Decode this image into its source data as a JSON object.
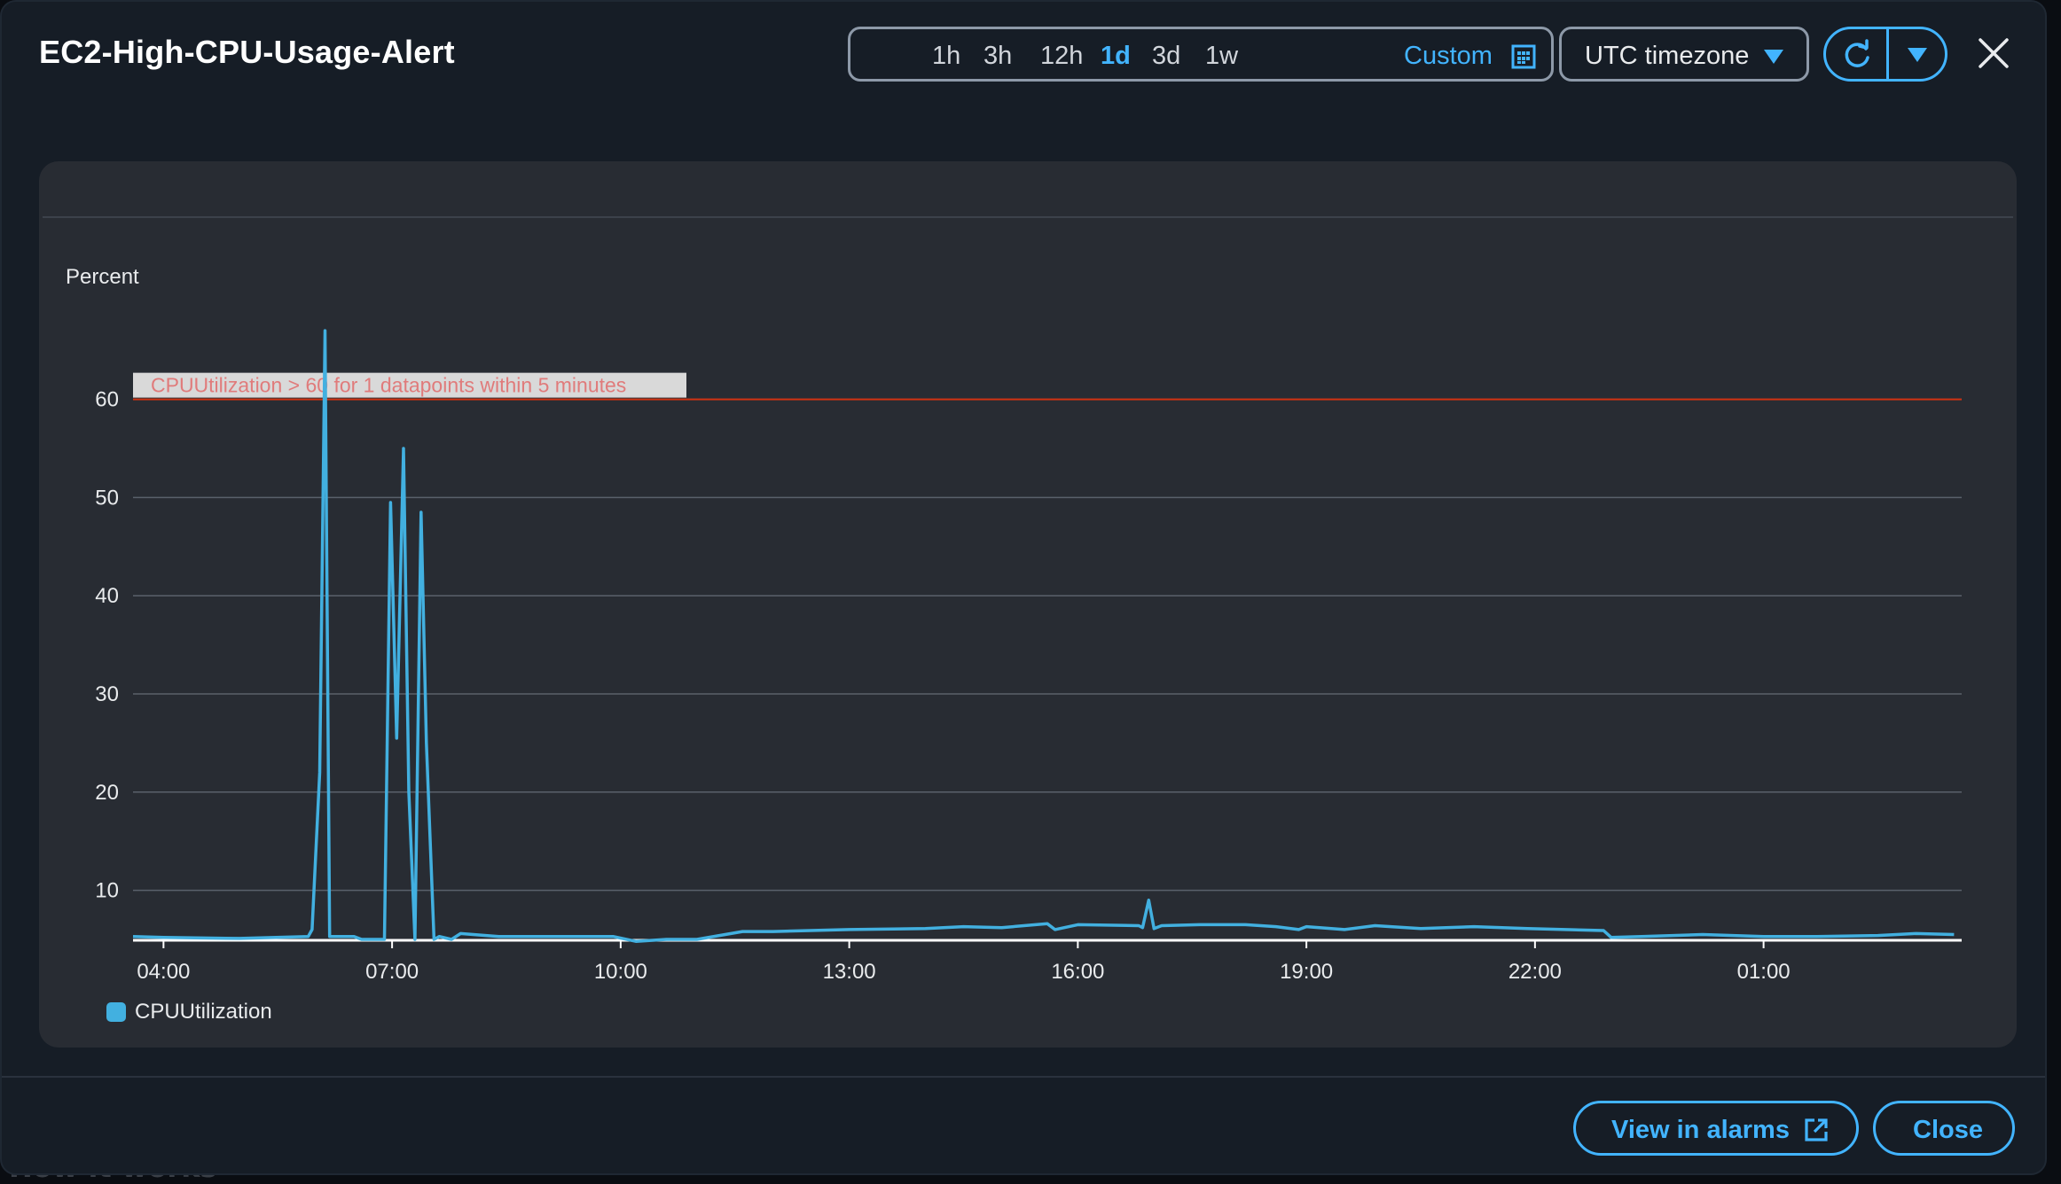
{
  "title": "EC2-High-CPU-Usage-Alert",
  "time_ranges": [
    {
      "label": "1h",
      "active": false
    },
    {
      "label": "3h",
      "active": false
    },
    {
      "label": "12h",
      "active": false
    },
    {
      "label": "1d",
      "active": true
    },
    {
      "label": "3d",
      "active": false
    },
    {
      "label": "1w",
      "active": false
    }
  ],
  "custom_label": "Custom",
  "timezone_label": "UTC timezone",
  "icons": {
    "calendar": "calendar-icon",
    "caret": "caret-down-icon",
    "refresh": "refresh-icon",
    "close": "close-icon",
    "external": "external-link-icon"
  },
  "colors": {
    "accent": "#42b4ff",
    "series": "#42b0e0",
    "threshold": "#d13212",
    "background": "#161d26",
    "panel": "#282c33"
  },
  "chart_data": {
    "type": "line",
    "ylabel": "Percent",
    "ylim": [
      5,
      68
    ],
    "yticks": [
      10,
      20,
      30,
      40,
      50,
      60
    ],
    "xlim": [
      3.6,
      27.6
    ],
    "xticks": [
      {
        "value": 4,
        "label": "04:00"
      },
      {
        "value": 7,
        "label": "07:00"
      },
      {
        "value": 10,
        "label": "10:00"
      },
      {
        "value": 13,
        "label": "13:00"
      },
      {
        "value": 16,
        "label": "16:00"
      },
      {
        "value": 19,
        "label": "19:00"
      },
      {
        "value": 22,
        "label": "22:00"
      },
      {
        "value": 25,
        "label": "01:00"
      }
    ],
    "grid": true,
    "threshold": {
      "value": 60,
      "label": "CPUUtilization > 60 for 1 datapoints within 5 minutes"
    },
    "series": [
      {
        "name": "CPUUtilization",
        "x": [
          3.6,
          4.0,
          5.0,
          5.9,
          5.95,
          6.05,
          6.12,
          6.18,
          6.5,
          6.6,
          6.9,
          6.98,
          7.06,
          7.15,
          7.22,
          7.3,
          7.38,
          7.45,
          7.55,
          7.62,
          7.78,
          7.9,
          8.4,
          9.5,
          9.9,
          10.2,
          10.6,
          11.0,
          11.6,
          12.0,
          13.0,
          14.0,
          14.5,
          15.0,
          15.6,
          15.7,
          16.0,
          16.8,
          16.85,
          16.93,
          17.0,
          17.1,
          17.6,
          18.2,
          18.6,
          18.9,
          19.0,
          19.5,
          19.9,
          20.5,
          21.2,
          21.9,
          22.4,
          22.9,
          23.0,
          23.4,
          24.2,
          25.0,
          25.7,
          26.5,
          27.0,
          27.5
        ],
        "values": [
          5.3,
          5.2,
          5.1,
          5.3,
          6.0,
          22.0,
          67.0,
          5.3,
          5.3,
          5.0,
          5.0,
          49.5,
          25.5,
          55.0,
          20.0,
          5.0,
          48.5,
          25.0,
          5.0,
          5.3,
          5.0,
          5.6,
          5.3,
          5.3,
          5.3,
          4.8,
          5.0,
          5.0,
          5.8,
          5.8,
          6.0,
          6.1,
          6.3,
          6.2,
          6.6,
          6.0,
          6.5,
          6.4,
          6.2,
          9.0,
          6.1,
          6.4,
          6.5,
          6.5,
          6.3,
          6.0,
          6.3,
          6.0,
          6.4,
          6.1,
          6.3,
          6.1,
          6.0,
          5.9,
          5.2,
          5.3,
          5.5,
          5.3,
          5.3,
          5.4,
          5.6,
          5.5
        ]
      }
    ]
  },
  "legend_label": "CPUUtilization",
  "footer": {
    "view_label": "View in alarms",
    "close_label": "Close"
  },
  "backdrop_text": "How it works"
}
